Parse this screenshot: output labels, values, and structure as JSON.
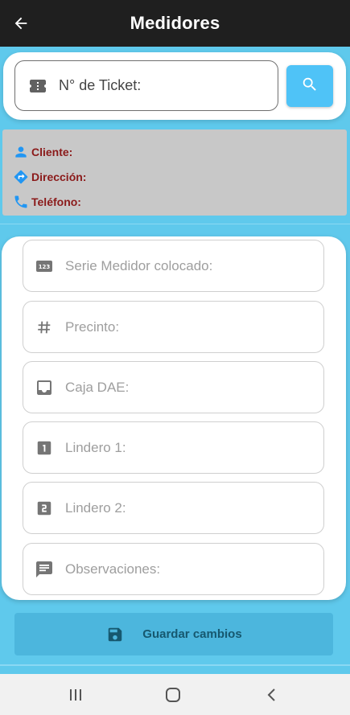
{
  "header": {
    "title": "Medidores",
    "back_icon": "arrow-back-icon"
  },
  "search": {
    "placeholder": "N° de Ticket:",
    "ticket_icon": "ticket-icon",
    "button_icon": "search-icon"
  },
  "info": {
    "client_label": "Cliente:",
    "address_label": "Dirección:",
    "phone_label": "Teléfono:"
  },
  "form": {
    "fields": [
      {
        "label": "Serie Medidor colocado:",
        "icon": "numbers-123-icon"
      },
      {
        "label": "Precinto:",
        "icon": "hash-icon"
      },
      {
        "label": "Caja DAE:",
        "icon": "inbox-icon"
      },
      {
        "label": "Lindero 1:",
        "icon": "looks-one-icon"
      },
      {
        "label": "Lindero 2:",
        "icon": "looks-two-icon"
      },
      {
        "label": "Observaciones:",
        "icon": "comment-icon"
      }
    ]
  },
  "save": {
    "label": "Guardar cambios",
    "icon": "save-icon"
  },
  "colors": {
    "background": "#5fc9ec",
    "appbar": "#1f1f1f",
    "accent": "#4fc3f7",
    "info_label": "#8b1a1a",
    "info_bg": "#c8c8c8",
    "save_bg": "#4cb6dd",
    "save_text": "#16586f"
  },
  "system_nav": {
    "recents_icon": "recents-icon",
    "home_icon": "home-icon",
    "back_icon": "back-chevron-icon"
  }
}
